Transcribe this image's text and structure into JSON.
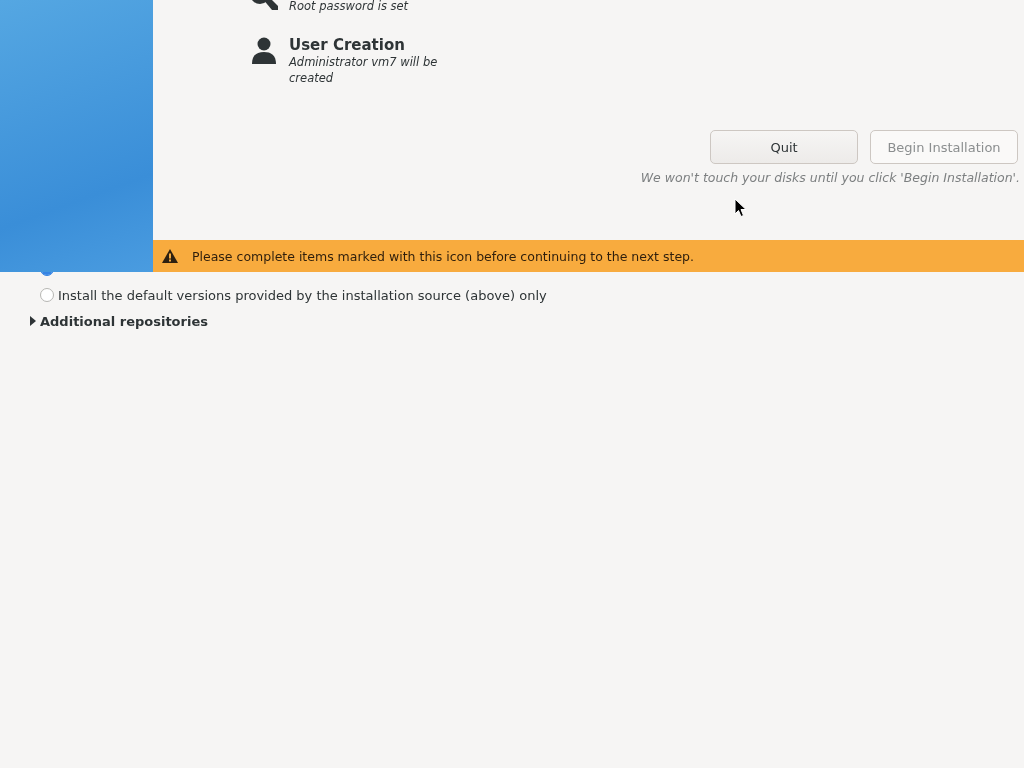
{
  "spokes": [
    {
      "kind": "key",
      "status": "Root password is set"
    },
    {
      "kind": "user",
      "title": "User Creation",
      "status": "Administrator vm7 will be created"
    }
  ],
  "buttons": [
    {
      "label": "Quit",
      "disabled": false
    },
    {
      "label": "Begin Installation",
      "disabled": true
    }
  ],
  "note": "We won't touch your disks until you click 'Begin Installation'.",
  "warning": {
    "message": "Please complete items marked with this icon before continuing to the next step."
  },
  "options": [
    {
      "selected": true
    },
    {
      "label": "Install the default versions provided by the installation source (above) only",
      "selected": false
    }
  ],
  "expander": {
    "label": "Additional repositories",
    "expanded": false
  }
}
